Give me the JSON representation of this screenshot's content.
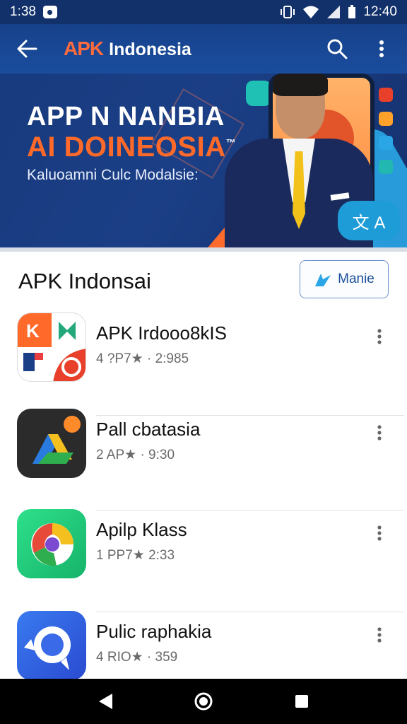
{
  "status_bar": {
    "time_left": "1:38",
    "time_right": "12:40"
  },
  "app_bar": {
    "logo": "APK",
    "title": "Indonesia"
  },
  "banner": {
    "headline1": "APP N NANBIA",
    "headline2": "AI DOINEOSIA",
    "headline2_mark": "™",
    "subline": "Kaluoamni Culc Modalsie:",
    "badge": "文 A"
  },
  "section": {
    "title": "APK Indonsai",
    "manage_label": "Manie"
  },
  "apps": [
    {
      "name": "APK Irdooo8kIS",
      "meta": "4 ?P7★ · 2:985"
    },
    {
      "name": "Pall cbatasia",
      "meta": "2 AP★ · 9:30"
    },
    {
      "name": "Apilp Klass",
      "meta": "1 PP7★ 2:33"
    },
    {
      "name": "Pulic raphakia",
      "meta": "4 RIO★ · 359"
    }
  ],
  "colors": {
    "app_bar": "#1a4d9e",
    "accent_orange": "#ff6a2a",
    "link_blue": "#1b4f9c"
  }
}
